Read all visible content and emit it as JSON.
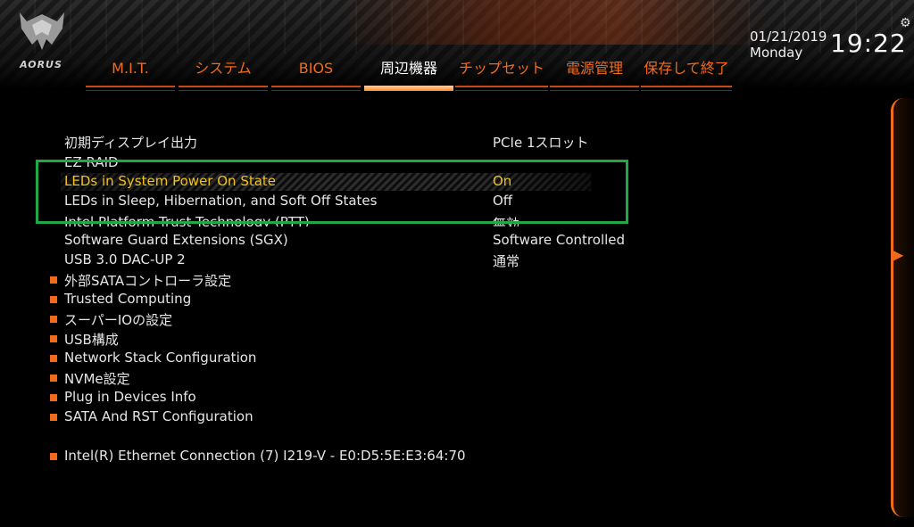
{
  "brand": {
    "logo_text": "AORUS"
  },
  "tabs": [
    {
      "label": "M.I.T.",
      "active": false
    },
    {
      "label": "システム",
      "active": false
    },
    {
      "label": "BIOS",
      "active": false
    },
    {
      "label": "周辺機器",
      "active": true
    },
    {
      "label": "チップセット",
      "active": false
    },
    {
      "label": "電源管理",
      "active": false
    },
    {
      "label": "保存して終了",
      "active": false
    }
  ],
  "clock": {
    "date": "01/21/2019",
    "day": "Monday",
    "time": "19:22"
  },
  "settings": [
    {
      "label": "初期ディスプレイ出力",
      "value": "PCIe 1スロット"
    },
    {
      "label": "EZ RAID",
      "value": ""
    },
    {
      "label": "LEDs in System Power On State",
      "value": "On",
      "highlighted": true
    },
    {
      "label": "LEDs in Sleep, Hibernation, and Soft Off States",
      "value": "Off"
    },
    {
      "label": "Intel Platform Trust Technology (PTT)",
      "value": "無効"
    },
    {
      "label": "Software Guard Extensions (SGX)",
      "value": "Software Controlled"
    },
    {
      "label": "USB 3.0 DAC-UP 2",
      "value": "通常"
    }
  ],
  "submenus": [
    {
      "label": "外部SATAコントローラ設定"
    },
    {
      "label": "Trusted Computing"
    },
    {
      "label": "スーパーIOの設定"
    },
    {
      "label": "USB構成"
    },
    {
      "label": "Network Stack Configuration"
    },
    {
      "label": "NVMe設定"
    },
    {
      "label": "Plug in Devices Info"
    },
    {
      "label": "SATA And RST Configuration"
    },
    {
      "label": "Intel(R) Ethernet Connection (7) I219-V - E0:D5:5E:E3:64:70"
    }
  ],
  "colors": {
    "accent": "#f26a1b",
    "highlight": "#f2c318",
    "annotation": "#1fa846"
  },
  "icons": {
    "settings": "gear-icon",
    "side_panel": "chevron-right-icon"
  }
}
